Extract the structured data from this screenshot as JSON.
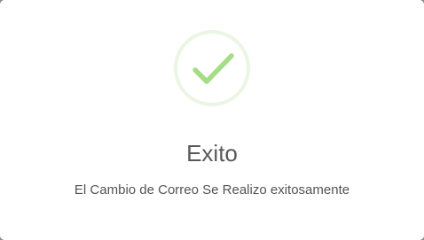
{
  "dialog": {
    "icon": "success-check-icon",
    "title": "Exito",
    "message": "El Cambio de Correo Se Realizo exitosamente",
    "colors": {
      "accent": "#a5dc86",
      "ring": "#eaf6e3",
      "title": "#595959",
      "text": "#545454"
    }
  }
}
